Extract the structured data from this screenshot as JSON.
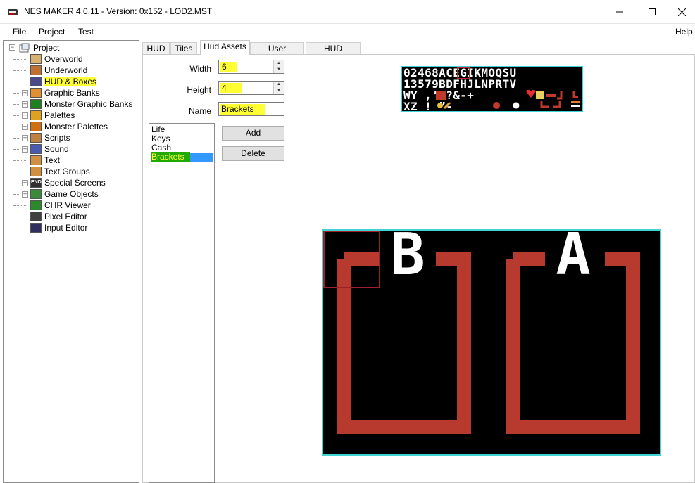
{
  "window": {
    "title": "NES MAKER 4.0.11 - Version: 0x152 - LOD2.MST",
    "minimize_glyph": "—",
    "maximize_glyph": "☐",
    "close_glyph": "✕"
  },
  "menu": {
    "file": "File",
    "project": "Project",
    "test": "Test",
    "help": "Help"
  },
  "tree": {
    "root": "Project",
    "items": [
      {
        "label": "Overworld",
        "icon": "overworld-icon"
      },
      {
        "label": "Underworld",
        "icon": "underworld-icon"
      },
      {
        "label": "HUD & Boxes",
        "icon": "hud-icon",
        "highlighted": true
      },
      {
        "label": "Graphic Banks",
        "icon": "graphic-banks-icon"
      },
      {
        "label": "Monster Graphic Banks",
        "icon": "monster-banks-icon"
      },
      {
        "label": "Palettes",
        "icon": "palettes-icon"
      },
      {
        "label": "Monster Palettes",
        "icon": "monster-palettes-icon"
      },
      {
        "label": "Scripts",
        "icon": "scripts-icon"
      },
      {
        "label": "Sound",
        "icon": "sound-icon"
      },
      {
        "label": "Text",
        "icon": "text-icon"
      },
      {
        "label": "Text Groups",
        "icon": "text-groups-icon"
      },
      {
        "label": "Special Screens",
        "icon": "special-screens-icon"
      },
      {
        "label": "Game Objects",
        "icon": "game-objects-icon"
      },
      {
        "label": "CHR Viewer",
        "icon": "chr-viewer-icon"
      },
      {
        "label": "Pixel Editor",
        "icon": "pixel-editor-icon"
      },
      {
        "label": "Input Editor",
        "icon": "input-editor-icon"
      }
    ],
    "end_badge": "END"
  },
  "tabs": [
    "HUD",
    "Tiles",
    "Hud Assets",
    "User Variables",
    "HUD Elements"
  ],
  "active_tab": "Hud Assets",
  "form": {
    "width_label": "Width",
    "width_value": "6",
    "height_label": "Height",
    "height_value": "4",
    "name_label": "Name",
    "name_value": "Brackets"
  },
  "assets_list": {
    "items": [
      "Life",
      "Keys",
      "Cash",
      "Brackets"
    ],
    "selected": "Brackets"
  },
  "buttons": {
    "add": "Add",
    "delete": "Delete"
  },
  "tileset": {
    "row1": "02468ACEGIKMOQSU",
    "row2": "13579BDFHJLNPRTV",
    "row3": "WY  ,’ ?&-+",
    "row4": "XZ  !  ”-"
  },
  "preview": {
    "left_letter": "B",
    "right_letter": "A"
  },
  "colors": {
    "highlight": "#ffff33",
    "selection": "#3399ff",
    "cyan_border": "#3fd3d3",
    "bracket_red": "#b83a2e",
    "cursor_red": "#a0202a"
  }
}
